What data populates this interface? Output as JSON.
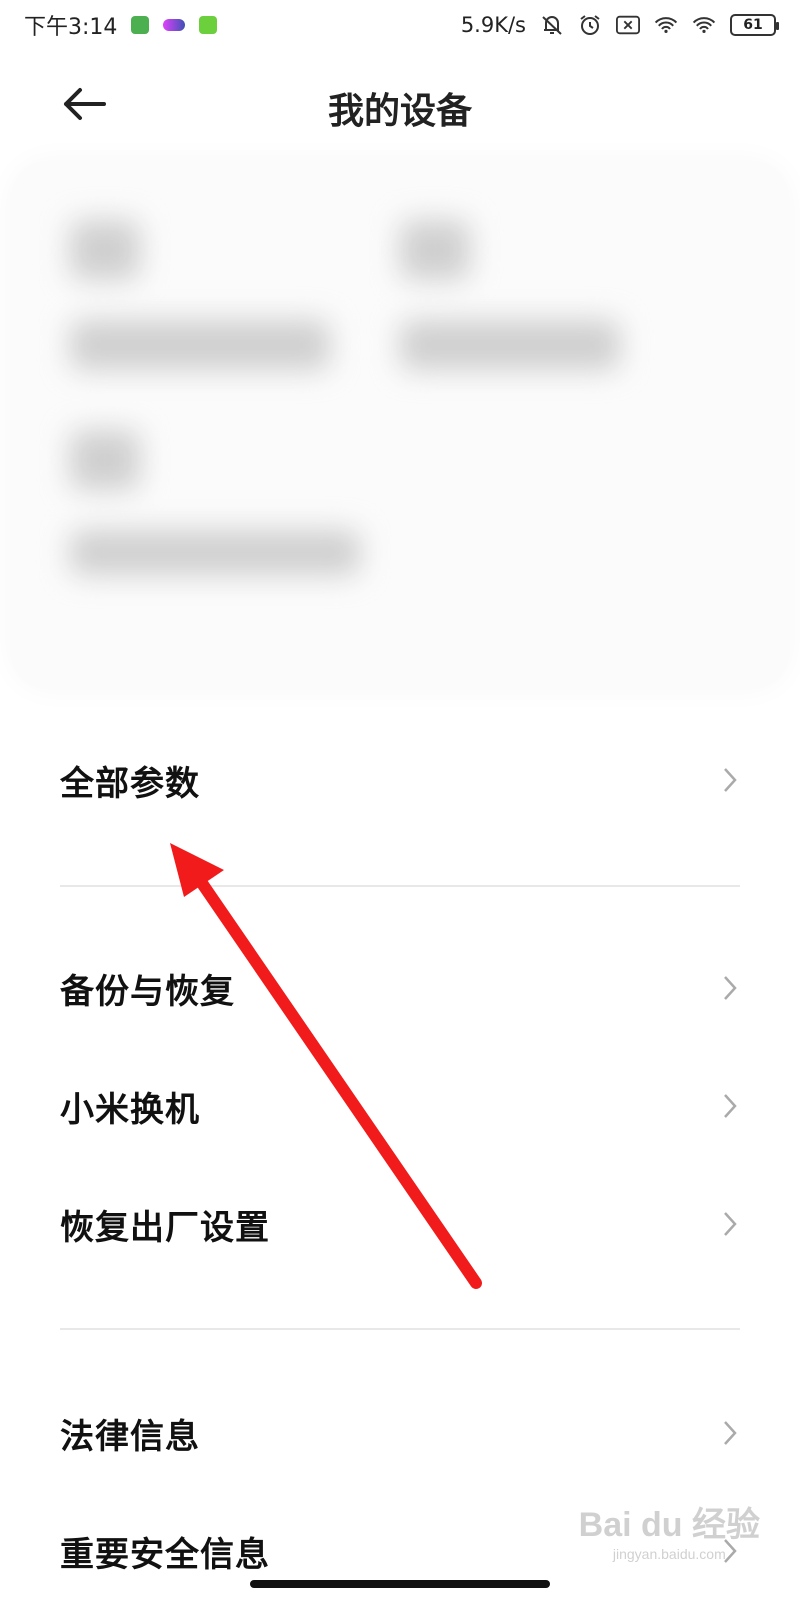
{
  "status_bar": {
    "time": "下午3:14",
    "net_speed": "5.9K/s",
    "battery": "61",
    "icons": [
      "app-green-icon",
      "app-colorful-icon",
      "app-lime-icon",
      "mute-bell-icon",
      "alarm-icon",
      "close-box-icon",
      "wifi-link-icon",
      "wifi-icon",
      "battery-icon"
    ]
  },
  "header": {
    "title": "我的设备",
    "back_icon": "back-arrow-icon"
  },
  "menu": {
    "items": [
      {
        "label": "全部参数"
      },
      {
        "label": "备份与恢复"
      },
      {
        "label": "小米换机"
      },
      {
        "label": "恢复出厂设置"
      },
      {
        "label": "法律信息"
      },
      {
        "label": "重要安全信息"
      }
    ]
  },
  "annotation": {
    "color": "#f21b1b"
  },
  "watermark": {
    "main": "Bai du 经验",
    "sub": "jingyan.baidu.com"
  }
}
